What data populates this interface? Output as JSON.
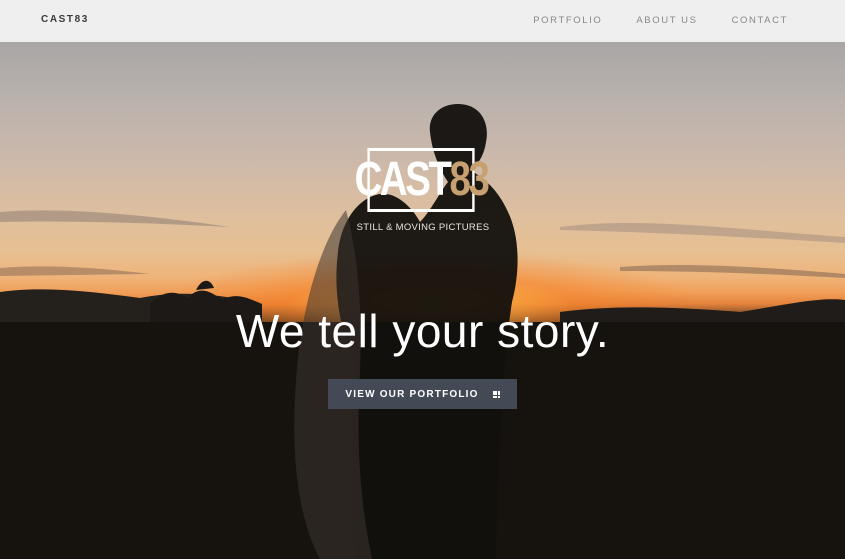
{
  "nav": {
    "brand": "CAST83",
    "links": [
      "PORTFOLIO",
      "ABOUT US",
      "CONTACT"
    ]
  },
  "hero": {
    "logo_part1": "CAST",
    "logo_part2": "83",
    "logo_tagline": "STILL & MOVING PICTURES",
    "headline": "We tell your story.",
    "cta_label": "VIEW OUR PORTFOLIO",
    "cta_icon": "grid-icon"
  },
  "colors": {
    "nav_bg": "#efefef",
    "logo_accent": "#c7a071",
    "cta_bg": "#434a56"
  }
}
